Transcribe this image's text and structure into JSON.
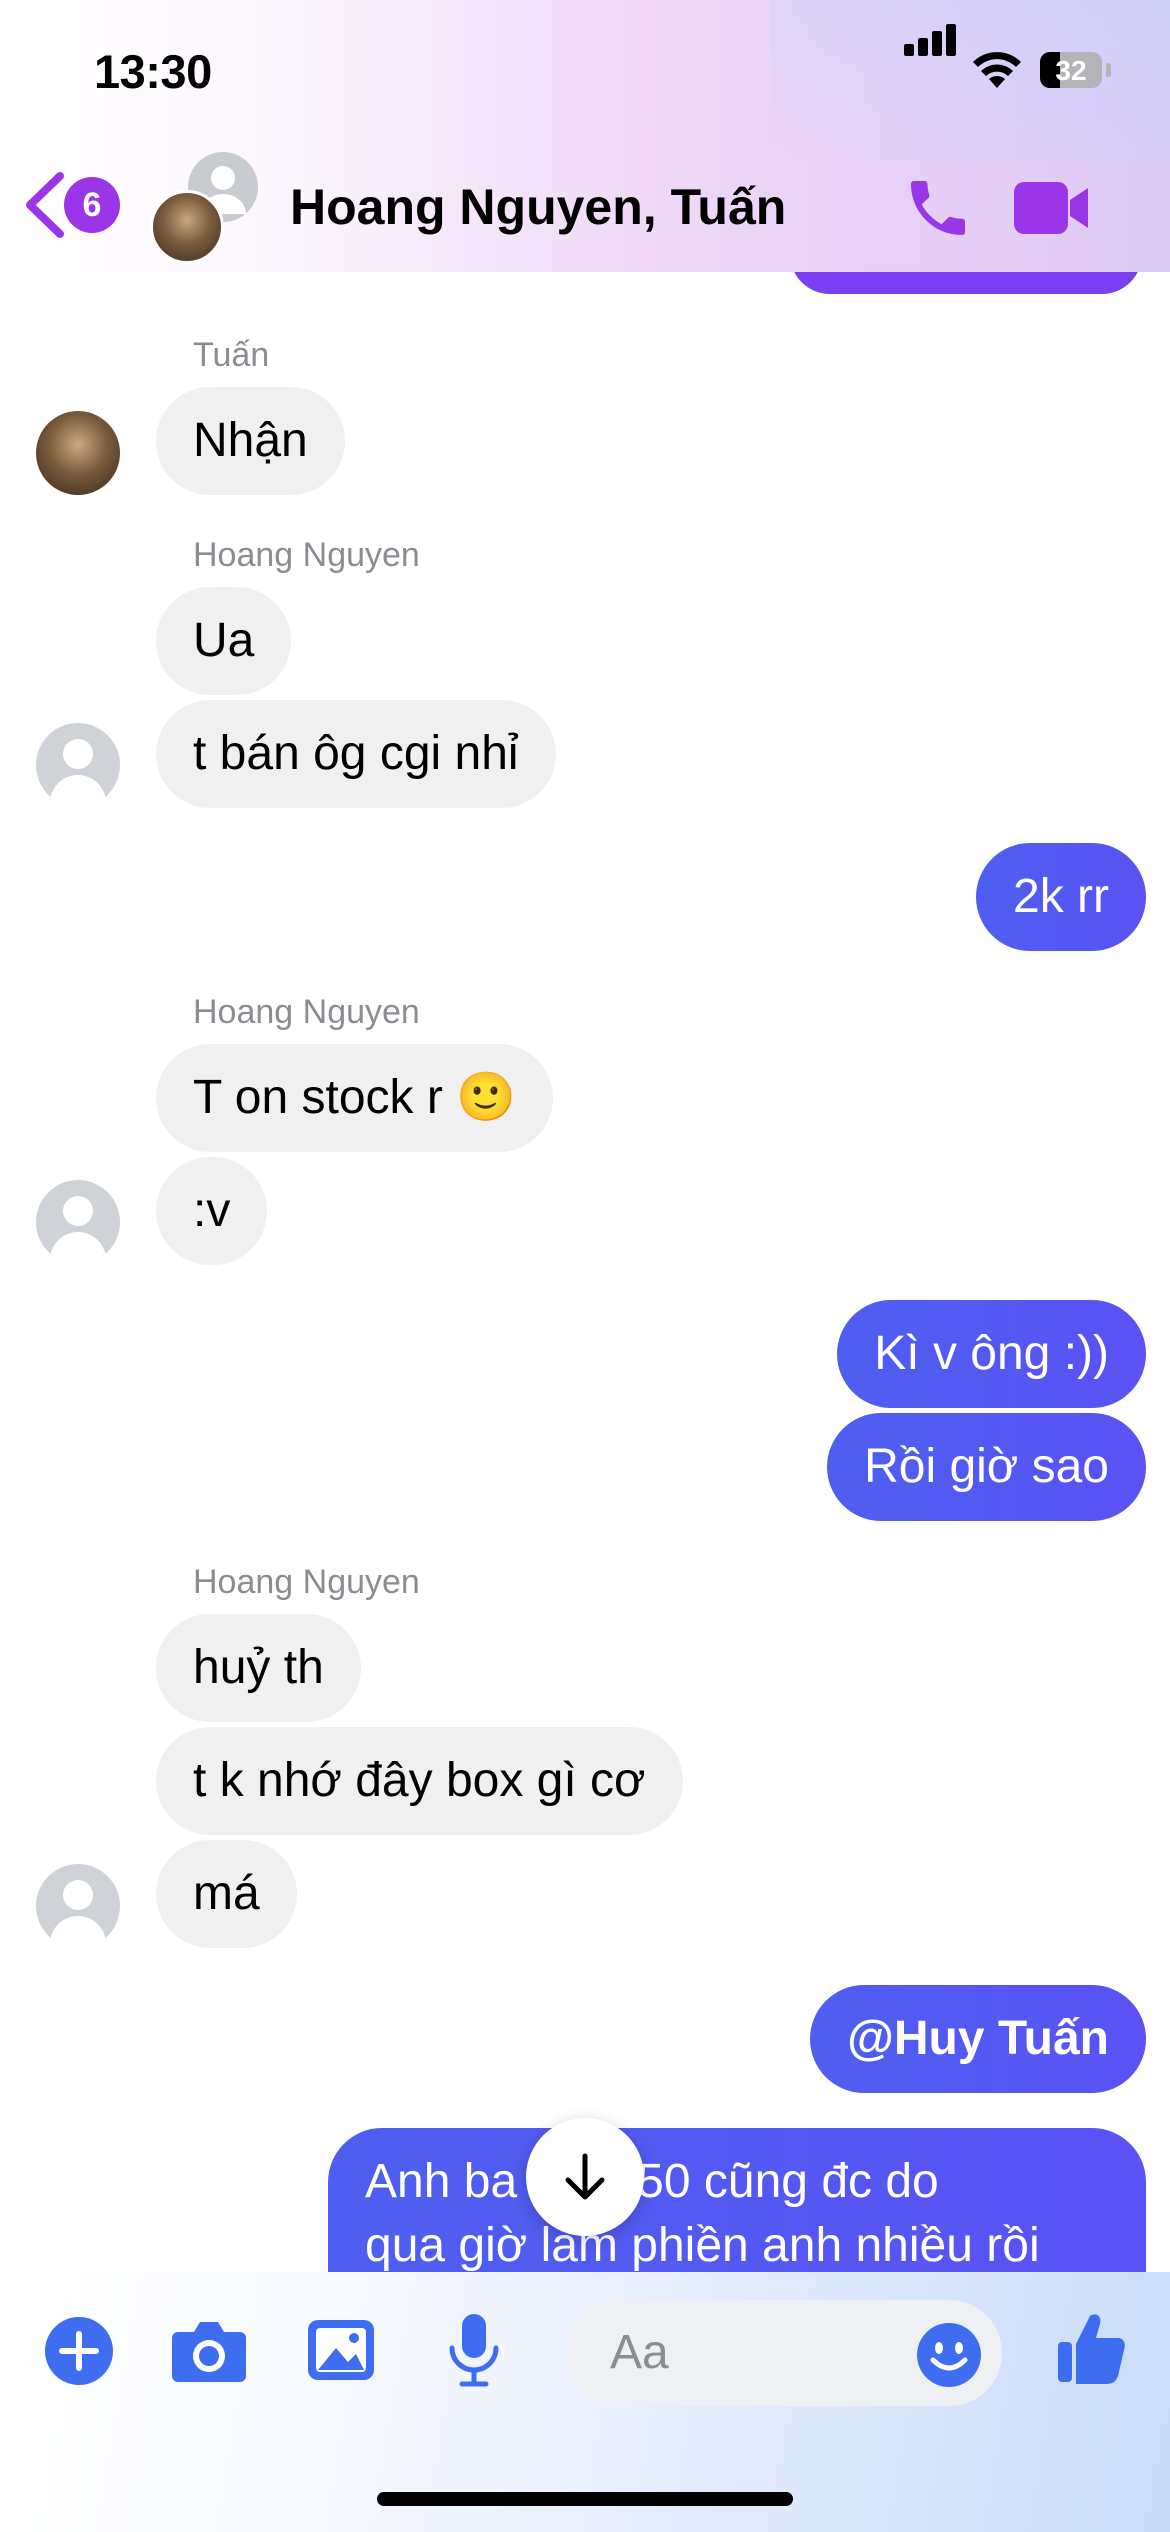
{
  "status_bar": {
    "time": "13:30",
    "battery": "32"
  },
  "header": {
    "back_badge": "6",
    "title": "Hoang Nguyen, Tuấn",
    "icons": [
      "back-chevron-icon",
      "phone-icon",
      "video-camera-icon"
    ]
  },
  "messages": [
    {
      "sender": "Tuấn",
      "text": "Nhận"
    },
    {
      "sender": "Hoang Nguyen",
      "text": "Ua"
    },
    {
      "sender": "Hoang Nguyen",
      "text": "t bán ôg cgi nhỉ"
    },
    {
      "sender": "me",
      "text": "2k rr"
    },
    {
      "sender": "Hoang Nguyen",
      "text": "T on stock r 🙂"
    },
    {
      "sender": "Hoang Nguyen",
      "text": ":v"
    },
    {
      "sender": "me",
      "text": "Kì v ông :))"
    },
    {
      "sender": "me",
      "text": "Rồi giờ sao"
    },
    {
      "sender": "Hoang Nguyen",
      "text": "huỷ th"
    },
    {
      "sender": "Hoang Nguyen",
      "text": "t k nhớ đây box gì cơ"
    },
    {
      "sender": "Hoang Nguyen",
      "text": "má"
    },
    {
      "sender": "me",
      "text": "@Huy Tuấn"
    },
    {
      "sender": "me",
      "line1": "Anh ba      em 350 cũng đc do",
      "line2": "qua giờ làm phiền anh nhiều rồi"
    }
  ],
  "composer": {
    "placeholder": "Aa",
    "icons": [
      "plus-icon",
      "camera-icon",
      "gallery-icon",
      "microphone-icon",
      "emoji-icon",
      "thumbs-up-icon"
    ]
  },
  "colors": {
    "accent": "#9a35e8",
    "outgoing": "#5058f2",
    "incoming": "#f0f0f0"
  }
}
